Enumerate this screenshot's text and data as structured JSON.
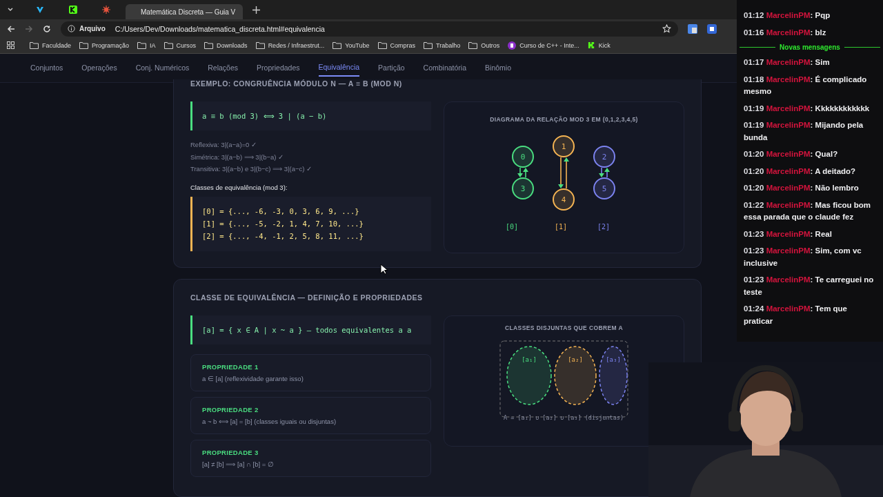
{
  "browser": {
    "tabs": [
      {
        "kind": "favicon-v",
        "selected": false
      },
      {
        "kind": "favicon-k",
        "selected": false
      },
      {
        "kind": "favicon-splat",
        "selected": false
      },
      {
        "kind": "globe",
        "title": "Matemática Discreta — Guia V",
        "selected": true
      }
    ],
    "address": {
      "security_label": "Arquivo",
      "url": "C:/Users/Dev/Downloads/matematica_discreta.html#equivalencia"
    },
    "bookmarks": [
      {
        "kind": "folder",
        "label": "Faculdade"
      },
      {
        "kind": "folder",
        "label": "Programação"
      },
      {
        "kind": "folder",
        "label": "IA"
      },
      {
        "kind": "folder",
        "label": "Cursos"
      },
      {
        "kind": "folder",
        "label": "Downloads"
      },
      {
        "kind": "folder",
        "label": "Redes / Infraestrut..."
      },
      {
        "kind": "folder",
        "label": "YouTube"
      },
      {
        "kind": "folder",
        "label": "Compras"
      },
      {
        "kind": "folder",
        "label": "Trabalho"
      },
      {
        "kind": "folder",
        "label": "Outros"
      },
      {
        "kind": "course",
        "label": "Curso de C++ - Inte..."
      },
      {
        "kind": "kick",
        "label": "Kick"
      }
    ]
  },
  "nav": [
    {
      "label": "Conjuntos",
      "selected": false
    },
    {
      "label": "Operações",
      "selected": false
    },
    {
      "label": "Conj. Numéricos",
      "selected": false
    },
    {
      "label": "Relações",
      "selected": false
    },
    {
      "label": "Propriedades",
      "selected": false
    },
    {
      "label": "Equivalência",
      "selected": true
    },
    {
      "label": "Partição",
      "selected": false
    },
    {
      "label": "Combinatória",
      "selected": false
    },
    {
      "label": "Binômio",
      "selected": false
    }
  ],
  "example": {
    "heading": "EXEMPLO: CONGRUÊNCIA MÓDULO N — A ≡ B (MOD N)",
    "formula": "a ≡ b (mod 3) ⟺ 3 | (a − b)",
    "properties": [
      "Reflexiva: 3|(a−a)=0 ✓",
      "Simétrica: 3|(a−b) ⟹ 3|(b−a) ✓",
      "Transitiva: 3|(a−b) e 3|(b−c) ⟹ 3|(a−c) ✓"
    ],
    "classes_title": "Classes de equivalência (mod 3):",
    "classes": [
      "[0] = {..., -6, -3, 0, 3, 6, 9, ...}",
      "[1] = {..., -5, -2, 1, 4, 7, 10, ...}",
      "[2] = {..., -4, -1, 2, 5, 8, 11, ...}"
    ],
    "diagram": {
      "title": "DIAGRAMA DA RELAÇÃO MOD 3 EM (0,1,2,3,4,5)",
      "classes": [
        {
          "label": "[0]",
          "color": "#4ade80",
          "nodes": [
            "0",
            "3"
          ]
        },
        {
          "label": "[1]",
          "color": "#f5b453",
          "nodes": [
            "1",
            "4"
          ]
        },
        {
          "label": "[2]",
          "color": "#7c83f0",
          "nodes": [
            "2",
            "5"
          ]
        }
      ]
    }
  },
  "equivalence": {
    "heading": "CLASSE DE EQUIVALÊNCIA — DEFINIÇÃO E PROPRIEDADES",
    "definition": "[a] = { x ∈ A | x ~ a } — todos equivalentes a a",
    "properties": [
      {
        "title": "PROPRIEDADE 1",
        "text": "a ∈ [a] (reflexividade garante isso)"
      },
      {
        "title": "PROPRIEDADE 2",
        "text": "a ~ b ⟺ [a] = [b] (classes iguais ou disjuntas)"
      },
      {
        "title": "PROPRIEDADE 3",
        "text": "[a] ≠ [b] ⟹ [a] ∩ [b] = ∅"
      }
    ],
    "diagram": {
      "title": "CLASSES DISJUNTAS QUE COBREM A",
      "sets": [
        {
          "label": "[a₁]",
          "color": "#4ade80"
        },
        {
          "label": "[a₂]",
          "color": "#f5b453"
        },
        {
          "label": "[a₃]",
          "color": "#7c83f0"
        }
      ],
      "caption": "A = [a₁] ∪ [a₂] ∪ [a₃] (disjuntas)"
    }
  },
  "chat": {
    "items": [
      {
        "kind": "message",
        "time": "01:12",
        "user": "MarcelinPM",
        "sep": ":",
        "text": "Pqp"
      },
      {
        "kind": "message",
        "time": "01:16",
        "user": "MarcelinPM",
        "sep": ":",
        "text": "blz"
      },
      {
        "kind": "divider",
        "text": "Novas mensagens"
      },
      {
        "kind": "message",
        "time": "01:17",
        "user": "MarcelinPM",
        "sep": ":",
        "text": "Sim"
      },
      {
        "kind": "message",
        "time": "01:18",
        "user": "MarcelinPM",
        "sep": ":",
        "text": "É complicado mesmo"
      },
      {
        "kind": "message",
        "time": "01:19",
        "user": "MarcelinPM",
        "sep": ":",
        "text": "Kkkkkkkkkkkk"
      },
      {
        "kind": "message",
        "time": "01:19",
        "user": "MarcelinPM",
        "sep": ":",
        "text": "Mijando pela bunda"
      },
      {
        "kind": "message",
        "time": "01:20",
        "user": "MarcelinPM",
        "sep": ":",
        "text": "Qual?"
      },
      {
        "kind": "message",
        "time": "01:20",
        "user": "MarcelinPM",
        "sep": ":",
        "text": "A deitado?"
      },
      {
        "kind": "message",
        "time": "01:20",
        "user": "MarcelinPM",
        "sep": ":",
        "text": "Não lembro"
      },
      {
        "kind": "message",
        "time": "01:22",
        "user": "MarcelinPM",
        "sep": ":",
        "text": "Mas ficou bom essa parada que o claude fez"
      },
      {
        "kind": "message",
        "time": "01:23",
        "user": "MarcelinPM",
        "sep": ":",
        "text": "Real"
      },
      {
        "kind": "message",
        "time": "01:23",
        "user": "MarcelinPM",
        "sep": ":",
        "text": "Sim, com vc inclusive"
      },
      {
        "kind": "message",
        "time": "01:23",
        "user": "MarcelinPM",
        "sep": ":",
        "text": "Te carreguei no teste"
      },
      {
        "kind": "message",
        "time": "01:24",
        "user": "MarcelinPM",
        "sep": ":",
        "text": "Tem que praticar"
      }
    ]
  }
}
